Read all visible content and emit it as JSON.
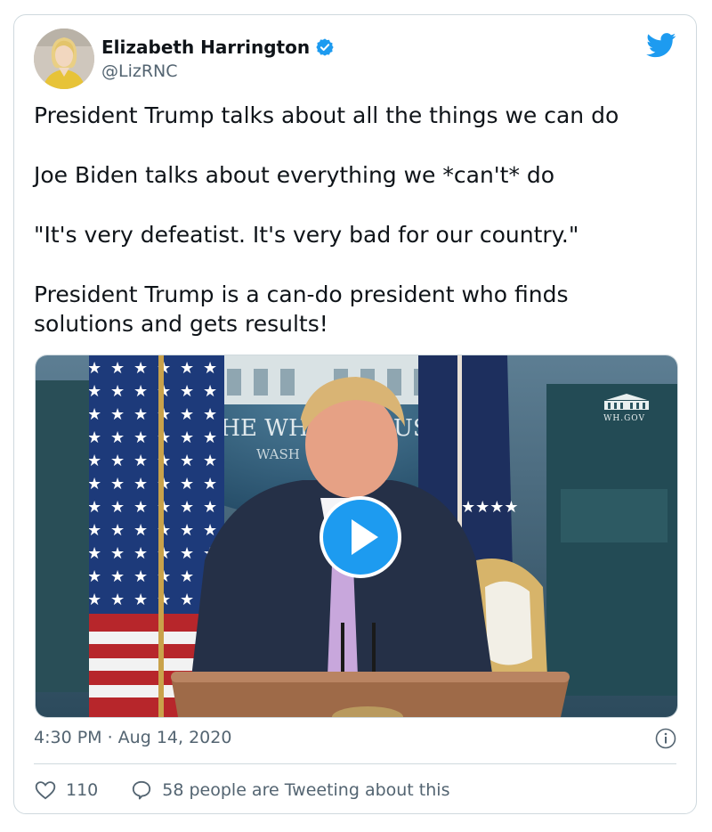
{
  "author": {
    "display_name": "Elizabeth Harrington",
    "handle": "@LizRNC"
  },
  "tweet": {
    "paragraphs": [
      "President Trump talks about all the things we can do",
      "Joe Biden talks about everything we *can't* do",
      "\"It's very defeatist. It's very bad for our country.\"",
      "President Trump is a can-do president who finds solutions and gets results!"
    ]
  },
  "media": {
    "wh_label": "WH.GOV",
    "backdrop_text_1": "THE WH",
    "backdrop_text_2": "US",
    "backdrop_text_3": "WASH"
  },
  "meta": {
    "timestamp": "4:30 PM · Aug 14, 2020"
  },
  "actions": {
    "likes": "110",
    "tweeting_about": "58 people are Tweeting about this"
  },
  "colors": {
    "brand": "#1d9bf0",
    "text": "#0f1419",
    "muted": "#536471",
    "border": "#cfd9de"
  }
}
